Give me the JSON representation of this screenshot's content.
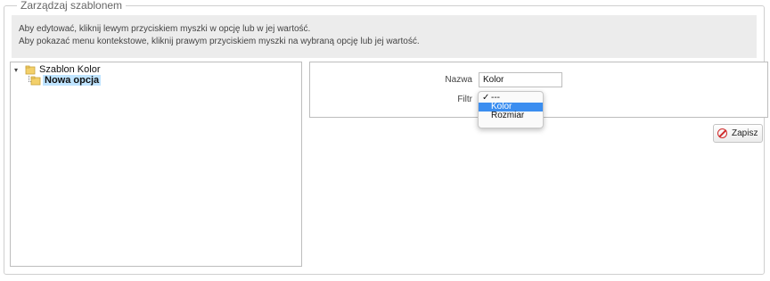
{
  "panel": {
    "title": "Zarządzaj szablonem",
    "info_line1": "Aby edytować, kliknij lewym przyciskiem myszki w opcję lub w jej wartość.",
    "info_line2": "Aby pokazać menu kontekstowe, kliknij prawym przyciskiem myszki na wybraną opcję lub jej wartość."
  },
  "tree": {
    "root": {
      "label": "Szablon Kolor",
      "icon": "folder-icon",
      "expanded": true
    },
    "children": [
      {
        "label": "Nowa opcja",
        "icon": "folder-icon",
        "selected": true
      }
    ]
  },
  "form": {
    "name_label": "Nazwa",
    "name_value": "Kolor",
    "filter_label": "Filtr",
    "filter_options": [
      {
        "label": "---",
        "checked": true
      },
      {
        "label": "Kolor",
        "highlighted": true
      },
      {
        "label": "Rozmiar"
      }
    ],
    "save_label": "Zapisz",
    "save_icon": "cancel-circle-icon"
  },
  "colors": {
    "selected_bg": "#bfe4ff",
    "highlight": "#3b8ef0",
    "save_icon_color": "#d02b2b"
  }
}
